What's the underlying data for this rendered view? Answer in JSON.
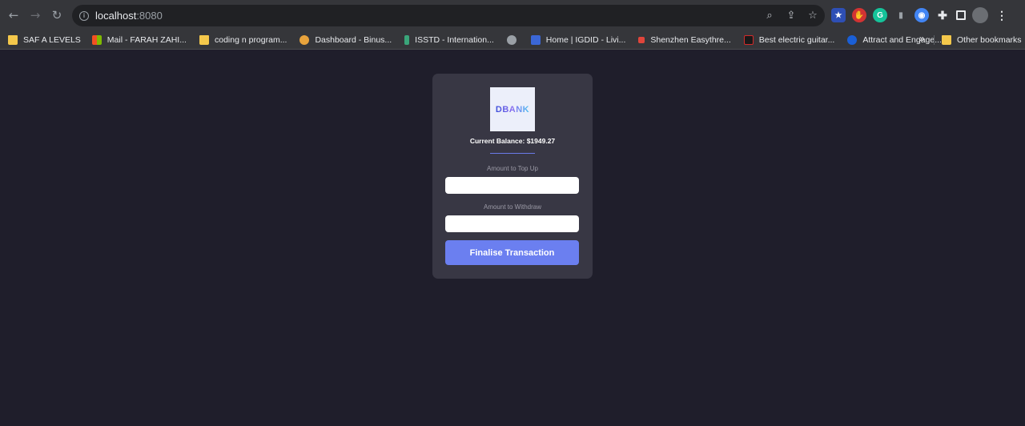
{
  "browser": {
    "url_host": "localhost",
    "url_port": ":8080",
    "bookmarks": [
      {
        "label": "SAF A LEVELS",
        "icon": "folder-icon",
        "color": "#f4c84b"
      },
      {
        "label": "Mail - FARAH ZAHI...",
        "icon": "microsoft-icon",
        "color": "#f25022"
      },
      {
        "label": "coding n program...",
        "icon": "folder-icon",
        "color": "#f4c84b"
      },
      {
        "label": "Dashboard - Binus...",
        "icon": "binus-icon",
        "color": "#e8a33c"
      },
      {
        "label": "ISSTD - Internation...",
        "icon": "isstd-icon",
        "color": "#3aa57a"
      },
      {
        "label": "",
        "icon": "globe-icon",
        "color": "#9aa0a6"
      },
      {
        "label": "Home | IGDID - Livi...",
        "icon": "igdid-icon",
        "color": "#3b67d6"
      },
      {
        "label": "Shenzhen Easythre...",
        "icon": "easythre-icon",
        "color": "#e0453b"
      },
      {
        "label": "Best electric guitar...",
        "icon": "guitar-icon",
        "color": "#d22a2a"
      },
      {
        "label": "Attract and Engage...",
        "icon": "c-icon",
        "color": "#1a5fd6"
      }
    ],
    "bookmarks_more": "»",
    "other_bookmarks": "Other bookmarks"
  },
  "app": {
    "logo_text": "DBANK",
    "balance_text": "Current Balance: $1949.27",
    "topup_label": "Amount to Top Up",
    "topup_value": "",
    "withdraw_label": "Amount to Withdraw",
    "withdraw_value": "",
    "submit_label": "Finalise Transaction"
  }
}
